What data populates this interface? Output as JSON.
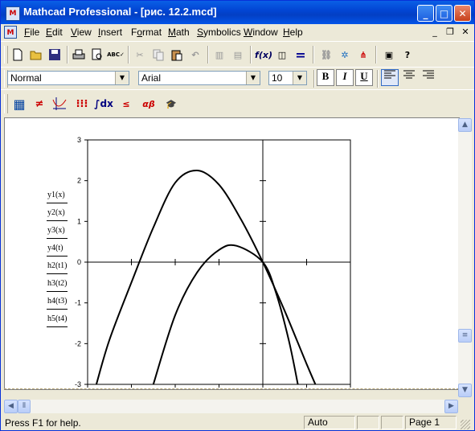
{
  "window": {
    "title": "Mathcad Professional - [рис. 12.2.mcd]"
  },
  "menu": [
    "File",
    "Edit",
    "View",
    "Insert",
    "Format",
    "Math",
    "Symbolics",
    "Window",
    "Help"
  ],
  "menu_underline": [
    "F",
    "E",
    "V",
    "I",
    "o",
    "M",
    "S",
    "W",
    "H"
  ],
  "format_bar": {
    "style": "Normal",
    "font": "Arial",
    "size": "10",
    "bold": "B",
    "italic": "I",
    "underline": "U"
  },
  "plot": {
    "legend": [
      "y1(x)",
      "y2(x)",
      "y3(x)",
      "y4(t)",
      "h2(t1)",
      "h3(t2)",
      "h4(t3)",
      "h5(t4)"
    ]
  },
  "chart_data": {
    "type": "line",
    "title": "",
    "xlabel": "",
    "ylabel": "",
    "xlim": [
      -4,
      2
    ],
    "ylim": [
      -3,
      3
    ],
    "x_ticks": [
      "-4",
      "-3",
      "-2",
      "-1",
      "0",
      "1",
      "2"
    ],
    "y_ticks": [
      "3",
      "2",
      "1",
      "0",
      "-1",
      "-2",
      "-3"
    ],
    "series": [
      {
        "x": [
          -3.8,
          -3.5,
          -3.0,
          -2.5,
          -2.0,
          -1.5,
          -1.0,
          -0.5,
          0.0,
          0.5,
          1.0,
          1.2
        ],
        "y": [
          -3.0,
          -1.9,
          -0.5,
          0.85,
          1.95,
          2.25,
          1.9,
          1.05,
          0.0,
          -1.2,
          -2.5,
          -3.0
        ]
      },
      {
        "x": [
          -2.5,
          -2.0,
          -1.5,
          -1.0,
          -0.6,
          0.0,
          0.3,
          0.6,
          0.8
        ],
        "y": [
          -3.0,
          -1.3,
          -0.25,
          0.3,
          0.4,
          0.0,
          -0.75,
          -1.95,
          -3.0
        ]
      }
    ]
  },
  "status": {
    "help": "Press F1 for help.",
    "mode": "Auto",
    "page": "Page 1"
  }
}
